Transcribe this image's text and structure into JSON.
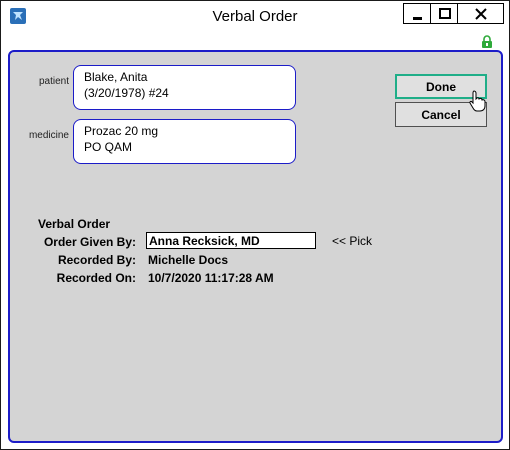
{
  "window": {
    "title": "Verbal Order"
  },
  "patient": {
    "label": "patient",
    "line1": "Blake, Anita",
    "line2": "(3/20/1978) #24"
  },
  "medicine": {
    "label": "medicine",
    "line1": "Prozac 20 mg",
    "line2": "PO QAM"
  },
  "buttons": {
    "done": "Done",
    "cancel": "Cancel"
  },
  "verbal_order": {
    "title": "Verbal Order",
    "given_by_label": "Order Given By:",
    "given_by_value": "Anna Recksick, MD",
    "pick_label": "<< Pick",
    "recorded_by_label": "Recorded By:",
    "recorded_by_value": "Michelle Docs",
    "recorded_on_label": "Recorded On:",
    "recorded_on_value": "10/7/2020 11:17:28 AM"
  },
  "icons": {
    "app": "app-logo-icon",
    "minimize": "minimize-icon",
    "maximize": "maximize-icon",
    "close": "close-icon",
    "lock": "lock-icon",
    "cursor": "hand-cursor-icon"
  },
  "colors": {
    "panel_border": "#1c1cc8",
    "panel_bg": "#d4d4d4",
    "done_focus": "#1fae88",
    "lock": "#2eaa3a"
  }
}
